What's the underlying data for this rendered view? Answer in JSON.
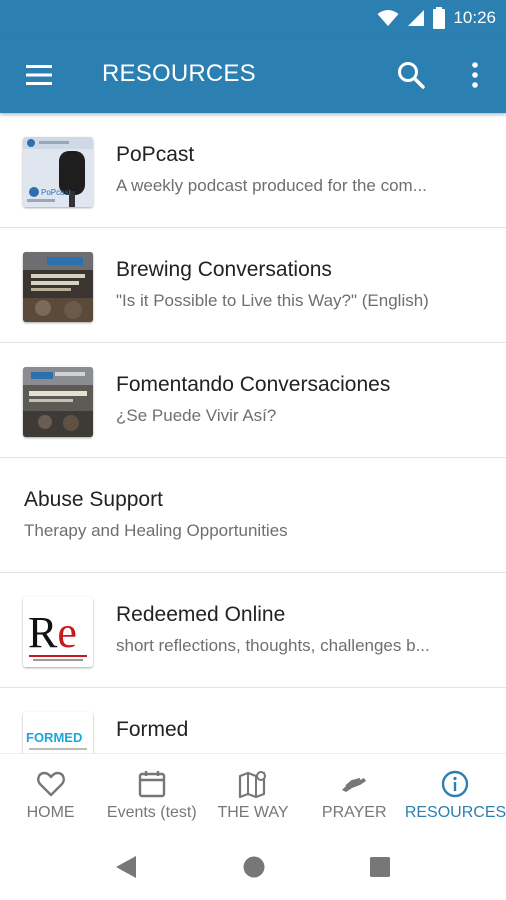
{
  "status": {
    "time": "10:26"
  },
  "appbar": {
    "title": "RESOURCES"
  },
  "items": [
    {
      "title": "PoPcast",
      "subtitle": "A weekly podcast produced for the com..."
    },
    {
      "title": "Brewing Conversations",
      "subtitle": "\"Is it Possible to Live this Way?\" (English)"
    },
    {
      "title": "Fomentando Conversaciones",
      "subtitle": "¿Se Puede Vivir Así?"
    },
    {
      "title": "Abuse Support",
      "subtitle": "Therapy and Healing Opportunities"
    },
    {
      "title": "Redeemed Online",
      "subtitle": "short reflections, thoughts, challenges b..."
    },
    {
      "title": "Formed",
      "subtitle": ""
    }
  ],
  "thumbs": {
    "redeemed_logo": "Re",
    "formed_logo": "FORMED",
    "popcast_logo": "PoPcast"
  },
  "tabs": [
    {
      "label": "HOME",
      "icon": "heart-icon"
    },
    {
      "label": "Events (test)",
      "icon": "calendar-icon"
    },
    {
      "label": "THE WAY",
      "icon": "map-icon"
    },
    {
      "label": "PRAYER",
      "icon": "praying-hands-icon"
    },
    {
      "label": "RESOURCES",
      "icon": "info-icon",
      "active": true
    }
  ],
  "colors": {
    "primary": "#2b7fb1",
    "text": "#222222",
    "subtext": "#6f6f6f",
    "inactive": "#777777"
  }
}
